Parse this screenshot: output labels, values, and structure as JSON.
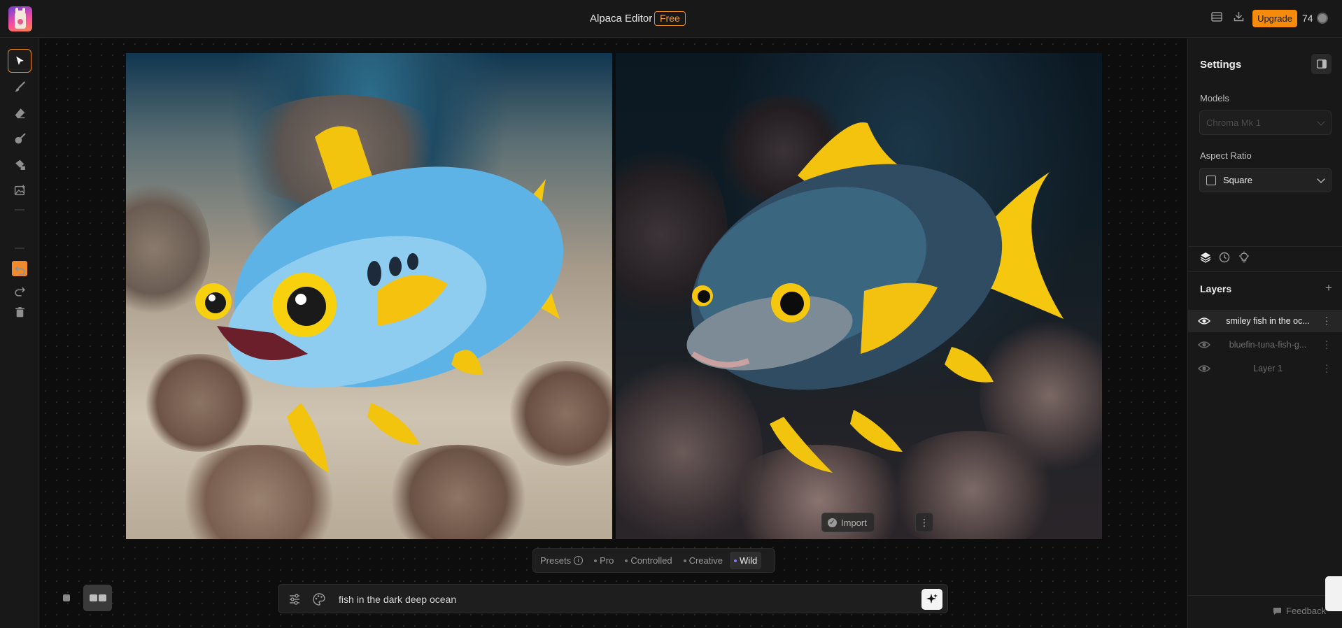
{
  "header": {
    "app_title": "Alpaca Editor",
    "plan_badge": "Free",
    "upgrade_label": "Upgrade",
    "credits": "74",
    "icons": [
      "gallery-icon",
      "download-icon"
    ]
  },
  "toolbar": {
    "tools": [
      "select-tool-icon",
      "brush-tool-icon",
      "eraser-tool-icon",
      "paint-tool-icon",
      "fill-tool-icon",
      "image-tool-icon"
    ],
    "active_tool": "select",
    "active_color": "#f08a2c",
    "history": [
      "undo-icon",
      "redo-icon",
      "delete-icon"
    ]
  },
  "canvas": {
    "import_label": "Import"
  },
  "presets": {
    "label": "Presets",
    "items": [
      "Pro",
      "Controlled",
      "Creative",
      "Wild"
    ],
    "active": "Wild"
  },
  "prompt": {
    "value": "fish in the dark deep ocean"
  },
  "settings": {
    "title": "Settings",
    "models_label": "Models",
    "model_value": "Chroma Mk 1",
    "aspect_label": "Aspect Ratio",
    "aspect_value": "Square"
  },
  "layers": {
    "title": "Layers",
    "items": [
      {
        "name": "smiley fish in the oc..."
      },
      {
        "name": "bluefin-tuna-fish-g..."
      },
      {
        "name": "Layer 1"
      }
    ]
  },
  "footer": {
    "feedback_label": "Feedback"
  },
  "colors": {
    "accent": "#f58a0b",
    "active_preset_dot": "#8a70ff"
  }
}
